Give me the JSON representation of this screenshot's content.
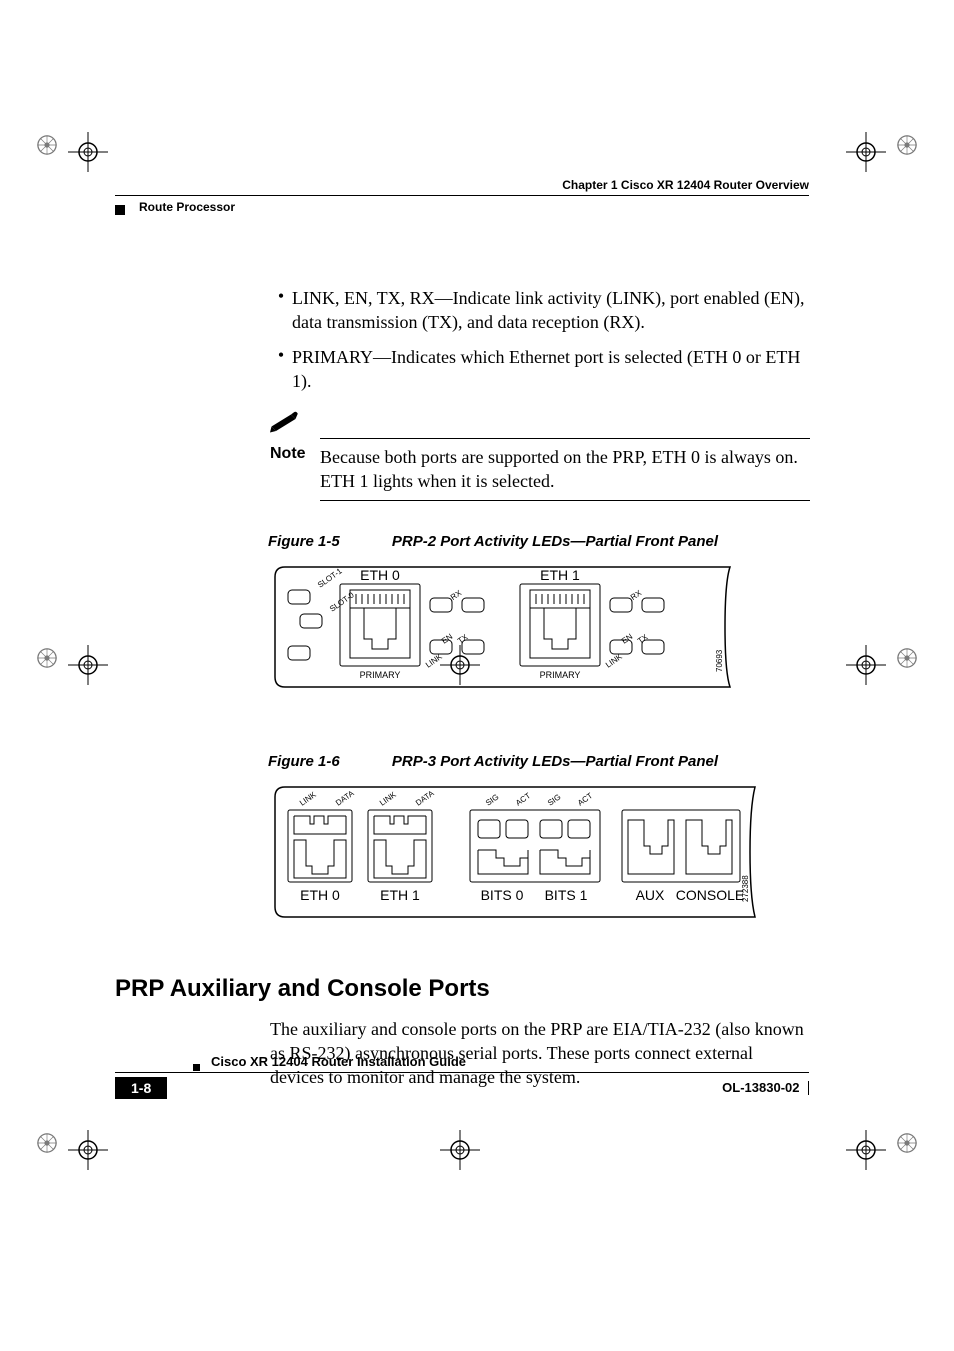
{
  "header": {
    "chapter": "Chapter 1      Cisco XR 12404 Router Overview",
    "section": "Route Processor"
  },
  "bullets": [
    "LINK, EN, TX, RX—Indicate link activity (LINK), port enabled (EN), data transmission (TX), and data reception (RX).",
    "PRIMARY—Indicates which Ethernet port is selected (ETH 0 or ETH 1)."
  ],
  "note": {
    "label": "Note",
    "text": "Because both ports are supported on the PRP, ETH 0 is always on. ETH 1 lights when it is selected."
  },
  "figures": {
    "f1": {
      "num": "Figure 1-5",
      "title": "PRP-2 Port Activity LEDs—Partial Front Panel",
      "labels": {
        "eth0": "ETH 0",
        "eth1": "ETH 1",
        "primary": "PRIMARY",
        "slot1": "SLOT-1",
        "slot0": "SLOT-0",
        "link": "LINK",
        "en": "EN",
        "tx": "TX",
        "rx": "RX",
        "id": "70693"
      }
    },
    "f2": {
      "num": "Figure 1-6",
      "title": "PRP-3 Port Activity LEDs—Partial Front Panel",
      "labels": {
        "eth0": "ETH 0",
        "eth1": "ETH 1",
        "bits0": "BITS 0",
        "bits1": "BITS 1",
        "aux": "AUX",
        "console": "CONSOLE",
        "link": "LINK",
        "data": "DATA",
        "sig": "SIG",
        "act": "ACT",
        "id": "272388"
      }
    }
  },
  "heading2": "PRP Auxiliary and Console Ports",
  "paragraph": "The auxiliary and console ports on the PRP are EIA/TIA-232 (also known as RS-232) asynchronous serial ports. These ports connect external devices to monitor and manage the system.",
  "footer": {
    "title": "Cisco XR 12404 Router Installation Guide",
    "pagenum": "1-8",
    "docid": "OL-13830-02"
  }
}
